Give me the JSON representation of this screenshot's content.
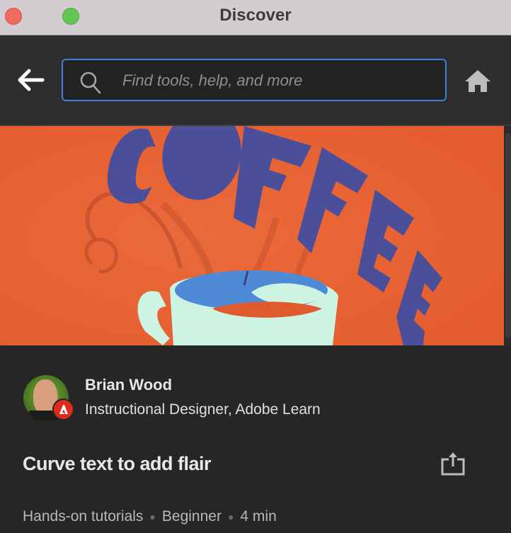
{
  "window": {
    "title": "Discover",
    "controls": [
      "close",
      "zoom"
    ]
  },
  "toolbar": {
    "back_icon": "arrow-left-icon",
    "search": {
      "icon": "search-icon",
      "value": "",
      "placeholder": "Find tools, help, and more"
    },
    "home_icon": "home-icon"
  },
  "hero": {
    "image_description": "Illustration of a coffee cup with the word COFFEE arched above it on an orange background",
    "word": "COFFEE",
    "colors": {
      "background": "#e86335",
      "lettering": "#4b4f9a",
      "cup": "#cdf3e3",
      "coffee_surface": "#4f8ad6"
    }
  },
  "author": {
    "name": "Brian Wood",
    "role": "Instructional Designer, Adobe Learn",
    "badge_icon": "adobe-logo-icon",
    "badge_color": "#e1291c"
  },
  "tutorial": {
    "title": "Curve text to add flair",
    "share_icon": "share-icon",
    "meta": {
      "category": "Hands-on tutorials",
      "level": "Beginner",
      "duration": "4 min"
    }
  },
  "colors": {
    "accent": "#3f7fe0",
    "panel": "#2e2e2e",
    "background": "#262626"
  }
}
